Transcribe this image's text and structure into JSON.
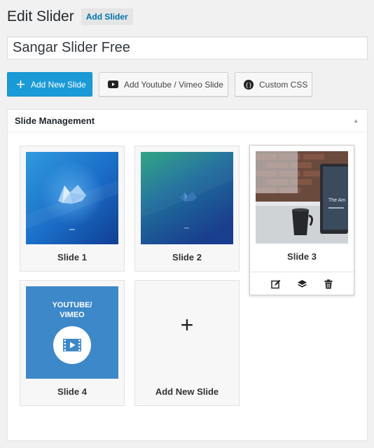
{
  "header": {
    "title": "Edit Slider",
    "add_slider": "Add Slider"
  },
  "slider_title": {
    "value": "Sangar Slider Free"
  },
  "toolbar": {
    "add_new_slide": "Add New Slide",
    "add_youtube_vimeo": "Add Youtube / Vimeo Slide",
    "custom_css": "Custom CSS"
  },
  "panel": {
    "title": "Slide Management"
  },
  "slides": [
    {
      "label": "Slide 1"
    },
    {
      "label": "Slide 2"
    },
    {
      "label": "Slide 3"
    },
    {
      "label": "Slide 4",
      "thumb_text_1": "YOUTUBE/",
      "thumb_text_2": "VIMEO"
    }
  ],
  "add_card": {
    "label": "Add New Slide",
    "symbol": "+"
  },
  "colors": {
    "primary": "#1a9bd7",
    "link": "#0073aa",
    "video_thumb_bg": "#3d88c9"
  },
  "icons": {
    "add": "plus-icon",
    "youtube": "youtube-icon",
    "css": "code-icon",
    "edit": "edit-icon",
    "layers": "layers-icon",
    "delete": "trash-icon"
  }
}
